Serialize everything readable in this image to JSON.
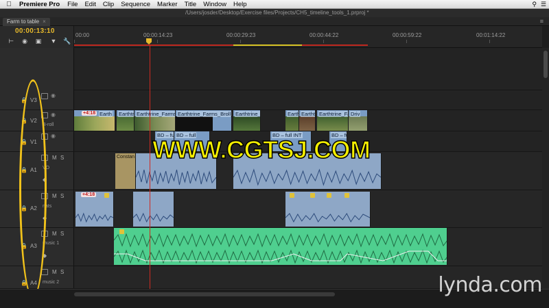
{
  "menubar": {
    "app_name": "Premiere Pro",
    "items": [
      "File",
      "Edit",
      "Clip",
      "Sequence",
      "Marker",
      "Title",
      "Window",
      "Help"
    ]
  },
  "window": {
    "path": "/Users/josder/Desktop/Exercise files/Projects/CH5_timeline_tools_1.prproj *"
  },
  "tab": {
    "label": "Farm to table",
    "close": "×"
  },
  "timecode": "00:00:13:10",
  "ruler": {
    "labels": [
      "00:00",
      "00:00:14:23",
      "00:00:29:23",
      "00:00:44:22",
      "00:00:59:22",
      "00:01:14:22"
    ]
  },
  "tracks": {
    "video": [
      {
        "name": "V3"
      },
      {
        "name": "V2",
        "sublabel": "B-roll"
      },
      {
        "name": "V1"
      }
    ],
    "audio": [
      {
        "name": "A1",
        "sublabel": "VO"
      },
      {
        "name": "A2",
        "sublabel": "nats"
      },
      {
        "name": "A3",
        "sublabel": "music 1"
      },
      {
        "name": "A4",
        "sublabel": "music 2"
      }
    ],
    "mute_label": "M",
    "solo_label": "S"
  },
  "v2_clips": [
    "Earth",
    "Earthtr",
    "Earthtrine_Farms",
    "Earthtrine_Farms_Broll_F",
    "Earthtrine_",
    "Earth",
    "Eartht",
    "Earthtrine_Fa",
    "Driv"
  ],
  "v2_badge": "+4:18",
  "v1_clips": [
    "BD – full",
    "BD – full",
    "BD – full INT",
    "BD – full IN"
  ],
  "a1_clip": "Constan",
  "a2_badge": "+4:18",
  "watermark": "WWW.CGTSJ.COM",
  "lynda": "lynda.com",
  "colors": {
    "accent": "#e6b82c",
    "playhead": "#cf2a21",
    "video_clip": "#7a9cc4",
    "audio_clip": "#8ea7c6",
    "music_clip": "#4fcf8f",
    "annotation": "#f1c21b"
  }
}
